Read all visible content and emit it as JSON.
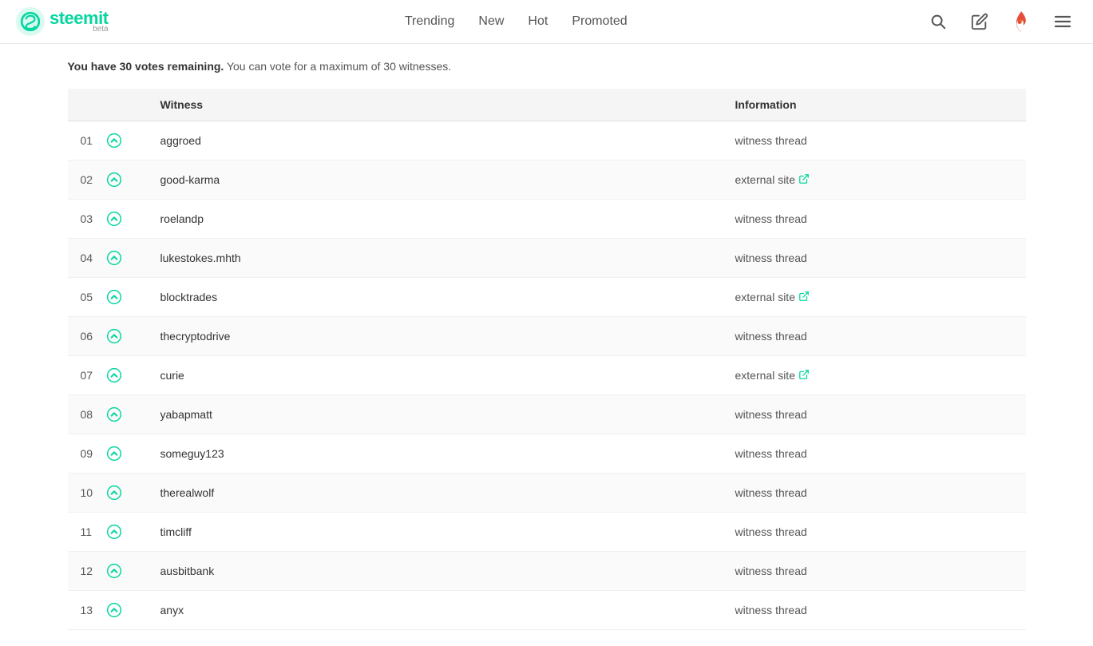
{
  "navbar": {
    "logo_name": "steemit",
    "logo_beta": "beta",
    "nav_items": [
      {
        "label": "Trending",
        "id": "trending"
      },
      {
        "label": "New",
        "id": "new"
      },
      {
        "label": "Hot",
        "id": "hot"
      },
      {
        "label": "Promoted",
        "id": "promoted"
      }
    ]
  },
  "notice": {
    "bold": "You have 30 votes remaining.",
    "normal": " You can vote for a maximum of 30 witnesses."
  },
  "table": {
    "col_rank": "",
    "col_witness": "Witness",
    "col_information": "Information",
    "rows": [
      {
        "rank": "01",
        "witness": "aggroed",
        "info_type": "witness thread",
        "info_external": false
      },
      {
        "rank": "02",
        "witness": "good-karma",
        "info_type": "external site",
        "info_external": true
      },
      {
        "rank": "03",
        "witness": "roelandp",
        "info_type": "witness thread",
        "info_external": false
      },
      {
        "rank": "04",
        "witness": "lukestokes.mhth",
        "info_type": "witness thread",
        "info_external": false
      },
      {
        "rank": "05",
        "witness": "blocktrades",
        "info_type": "external site",
        "info_external": true
      },
      {
        "rank": "06",
        "witness": "thecryptodrive",
        "info_type": "witness thread",
        "info_external": false
      },
      {
        "rank": "07",
        "witness": "curie",
        "info_type": "external site",
        "info_external": true
      },
      {
        "rank": "08",
        "witness": "yabapmatt",
        "info_type": "witness thread",
        "info_external": false
      },
      {
        "rank": "09",
        "witness": "someguy123",
        "info_type": "witness thread",
        "info_external": false
      },
      {
        "rank": "10",
        "witness": "therealwolf",
        "info_type": "witness thread",
        "info_external": false
      },
      {
        "rank": "11",
        "witness": "timcliff",
        "info_type": "witness thread",
        "info_external": false
      },
      {
        "rank": "12",
        "witness": "ausbitbank",
        "info_type": "witness thread",
        "info_external": false
      },
      {
        "rank": "13",
        "witness": "anyx",
        "info_type": "witness thread",
        "info_external": false
      }
    ]
  }
}
